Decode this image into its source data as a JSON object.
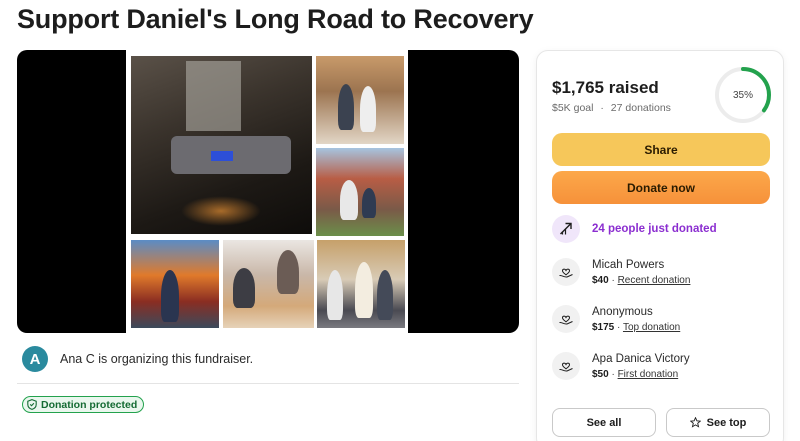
{
  "campaign": {
    "title": "Support Daniel's Long Road to Recovery",
    "organizer_initial": "A",
    "organizer_text": "Ana C is organizing this fundraiser.",
    "protection_badge": "Donation protected"
  },
  "stats": {
    "raised": "$1,765 raised",
    "goal": "$5K goal",
    "separator": "·",
    "donations": "27 donations",
    "progress_label": "35%",
    "progress_fraction": 0.35
  },
  "actions": {
    "share_label": "Share",
    "donate_label": "Donate now",
    "see_all_label": "See all",
    "see_top_label": "See top"
  },
  "recent": {
    "text": "24 people just donated"
  },
  "donors": [
    {
      "name": "Micah Powers",
      "amount": "$40",
      "tag": "Recent donation"
    },
    {
      "name": "Anonymous",
      "amount": "$175",
      "tag": "Top donation"
    },
    {
      "name": "Apa Danica Victory",
      "amount": "$50",
      "tag": "First donation"
    }
  ],
  "colors": {
    "accent_green": "#23a24d",
    "share_yellow": "#f6c75a",
    "donate_orange": "#f6913a",
    "trend_purple": "#8b2ed0",
    "avatar_teal": "#2a8a9e"
  },
  "icons": {
    "trend": "trending-up-icon",
    "donor": "heart-hand-icon",
    "star": "star-icon",
    "shield": "shield-check-icon"
  }
}
